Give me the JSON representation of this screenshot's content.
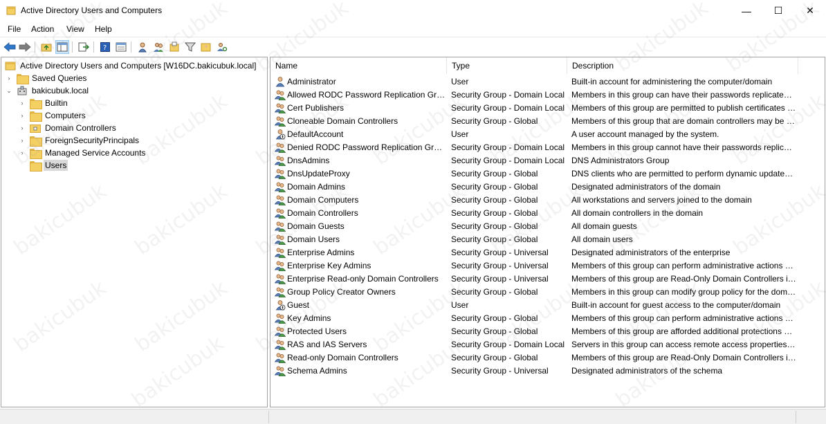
{
  "window": {
    "title": "Active Directory Users and Computers",
    "minimize_glyph": "—",
    "maximize_glyph": "☐",
    "close_glyph": "✕"
  },
  "menu": [
    "File",
    "Action",
    "View",
    "Help"
  ],
  "toolbar_icons": [
    "back-arrow-icon",
    "forward-arrow-icon",
    "up-folder-icon",
    "show-console-tree-icon",
    "export-list-icon",
    "help-icon",
    "properties-icon",
    "new-user-icon",
    "new-group-icon",
    "new-ou-icon",
    "filter-icon",
    "add-to-group-icon",
    "find-icon"
  ],
  "tree": {
    "root": "Active Directory Users and Computers [W16DC.bakicubuk.local]",
    "saved_queries": "Saved Queries",
    "domain": "bakicubuk.local",
    "children": [
      "Builtin",
      "Computers",
      "Domain Controllers",
      "ForeignSecurityPrincipals",
      "Managed Service Accounts",
      "Users"
    ]
  },
  "list": {
    "columns": [
      "Name",
      "Type",
      "Description"
    ],
    "rows": [
      {
        "name": "Administrator",
        "type": "User",
        "description": "Built-in account for administering the computer/domain",
        "icon": "user"
      },
      {
        "name": "Allowed RODC Password Replication Group",
        "type": "Security Group - Domain Local",
        "description": "Members in this group can have their passwords replicated to all read-only domain controllers",
        "icon": "group"
      },
      {
        "name": "Cert Publishers",
        "type": "Security Group - Domain Local",
        "description": "Members of this group are permitted to publish certificates to the directory",
        "icon": "group"
      },
      {
        "name": "Cloneable Domain Controllers",
        "type": "Security Group - Global",
        "description": "Members of this group that are domain controllers may be cloned.",
        "icon": "group"
      },
      {
        "name": "DefaultAccount",
        "type": "User",
        "description": "A user account managed by the system.",
        "icon": "user-disabled"
      },
      {
        "name": "Denied RODC Password Replication Group",
        "type": "Security Group - Domain Local",
        "description": "Members in this group cannot have their passwords replicated to any read-only domain controllers",
        "icon": "group"
      },
      {
        "name": "DnsAdmins",
        "type": "Security Group - Domain Local",
        "description": "DNS Administrators Group",
        "icon": "group"
      },
      {
        "name": "DnsUpdateProxy",
        "type": "Security Group - Global",
        "description": "DNS clients who are permitted to perform dynamic updates on behalf of some other clients",
        "icon": "group"
      },
      {
        "name": "Domain Admins",
        "type": "Security Group - Global",
        "description": "Designated administrators of the domain",
        "icon": "group"
      },
      {
        "name": "Domain Computers",
        "type": "Security Group - Global",
        "description": "All workstations and servers joined to the domain",
        "icon": "group"
      },
      {
        "name": "Domain Controllers",
        "type": "Security Group - Global",
        "description": "All domain controllers in the domain",
        "icon": "group"
      },
      {
        "name": "Domain Guests",
        "type": "Security Group - Global",
        "description": "All domain guests",
        "icon": "group"
      },
      {
        "name": "Domain Users",
        "type": "Security Group - Global",
        "description": "All domain users",
        "icon": "group"
      },
      {
        "name": "Enterprise Admins",
        "type": "Security Group - Universal",
        "description": "Designated administrators of the enterprise",
        "icon": "group"
      },
      {
        "name": "Enterprise Key Admins",
        "type": "Security Group - Universal",
        "description": "Members of this group can perform administrative actions on key objects within the forest.",
        "icon": "group"
      },
      {
        "name": "Enterprise Read-only Domain Controllers",
        "type": "Security Group - Universal",
        "description": "Members of this group are Read-Only Domain Controllers in the enterprise",
        "icon": "group"
      },
      {
        "name": "Group Policy Creator Owners",
        "type": "Security Group - Global",
        "description": "Members in this group can modify group policy for the domain",
        "icon": "group"
      },
      {
        "name": "Guest",
        "type": "User",
        "description": "Built-in account for guest access to the computer/domain",
        "icon": "user-disabled"
      },
      {
        "name": "Key Admins",
        "type": "Security Group - Global",
        "description": "Members of this group can perform administrative actions on key objects within the domain.",
        "icon": "group"
      },
      {
        "name": "Protected Users",
        "type": "Security Group - Global",
        "description": "Members of this group are afforded additional protections against authentication security threats.",
        "icon": "group"
      },
      {
        "name": "RAS and IAS Servers",
        "type": "Security Group - Domain Local",
        "description": "Servers in this group can access remote access properties of users",
        "icon": "group"
      },
      {
        "name": "Read-only Domain Controllers",
        "type": "Security Group - Global",
        "description": "Members of this group are Read-Only Domain Controllers in the domain",
        "icon": "group"
      },
      {
        "name": "Schema Admins",
        "type": "Security Group - Universal",
        "description": "Designated administrators of the schema",
        "icon": "group"
      }
    ]
  },
  "watermark_text": "bakicubuk",
  "colors": {
    "selection": "#d9d9d9",
    "toolbar_pressed": "#cce4f7",
    "folder": "#f4cf62"
  }
}
